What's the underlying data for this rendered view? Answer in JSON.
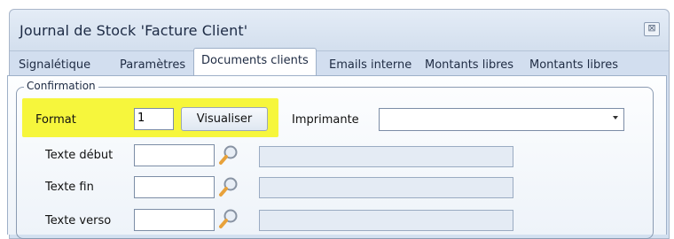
{
  "window": {
    "title": "Journal de Stock 'Facture Client'",
    "close_glyph": "⊠"
  },
  "tabs": [
    {
      "label": "Signalétique"
    },
    {
      "label": "Paramètres"
    },
    {
      "label": "Documents clients"
    },
    {
      "label": "Emails interne"
    },
    {
      "label": "Montants libres"
    },
    {
      "label": "Montants libres"
    }
  ],
  "group": {
    "label": "Confirmation"
  },
  "format": {
    "label": "Format",
    "value": "1",
    "button": "Visualiser"
  },
  "printer": {
    "label": "Imprimante",
    "value": ""
  },
  "rows": [
    {
      "label": "Texte début"
    },
    {
      "label": "Texte fin"
    },
    {
      "label": "Texte verso"
    }
  ],
  "colors": {
    "highlight": "#f6f63c",
    "accent": "#9eb0c8"
  },
  "icons": {
    "lookup": "search-icon",
    "dropdown": "chevron-down-icon",
    "close": "close-icon"
  }
}
